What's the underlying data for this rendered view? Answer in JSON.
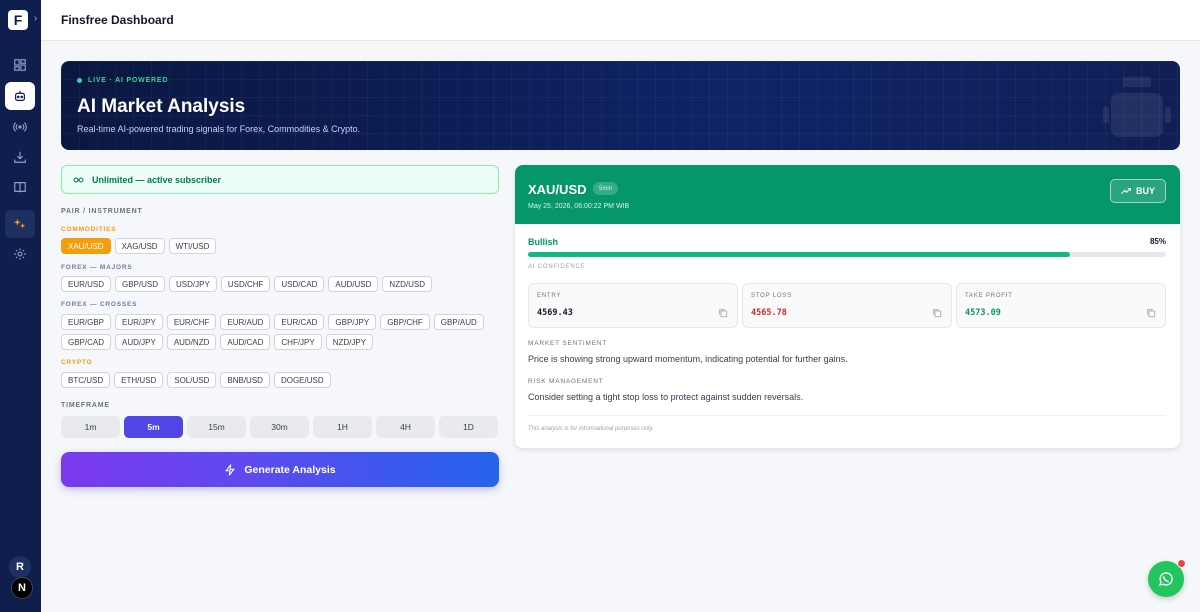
{
  "app": {
    "logo_letter": "F",
    "title": "Finsfree Dashboard"
  },
  "sidebar": {
    "items": [
      {
        "icon": "dashboard-icon"
      },
      {
        "icon": "robot-icon",
        "active": true
      },
      {
        "icon": "broadcast-icon"
      },
      {
        "icon": "download-icon"
      },
      {
        "icon": "book-icon"
      },
      {
        "icon": "sparkles-icon"
      },
      {
        "icon": "gear-icon"
      }
    ],
    "user_initial": "R",
    "user2_initial": "N"
  },
  "hero": {
    "badge": "LIVE · AI POWERED",
    "title": "AI Market Analysis",
    "subtitle": "Real-time AI-powered trading signals for Forex, Commodities & Crypto."
  },
  "subscription": {
    "text": "Unlimited — active subscriber"
  },
  "pairs": {
    "section_label": "PAIR / INSTRUMENT",
    "groups": [
      {
        "label": "COMMODITIES",
        "rows": [
          [
            "XAU/USD",
            "XAG/USD",
            "WTI/USD"
          ]
        ]
      },
      {
        "label": "FOREX — MAJORS",
        "rows": [
          [
            "EUR/USD",
            "GBP/USD",
            "USD/JPY",
            "USD/CHF",
            "USD/CAD",
            "AUD/USD",
            "NZD/USD"
          ]
        ]
      },
      {
        "label": "FOREX — CROSSES",
        "rows": [
          [
            "EUR/GBP",
            "EUR/JPY",
            "EUR/CHF",
            "EUR/AUD",
            "EUR/CAD",
            "GBP/JPY",
            "GBP/CHF",
            "GBP/AUD"
          ],
          [
            "GBP/CAD",
            "AUD/JPY",
            "AUD/NZD",
            "AUD/CAD",
            "CHF/JPY",
            "NZD/JPY"
          ]
        ]
      },
      {
        "label": "CRYPTO",
        "rows": [
          [
            "BTC/USD",
            "ETH/USD",
            "SOL/USD",
            "BNB/USD",
            "DOGE/USD"
          ]
        ]
      }
    ],
    "selected": "XAU/USD"
  },
  "timeframe": {
    "label": "TIMEFRAME",
    "options": [
      "1m",
      "5m",
      "15m",
      "30m",
      "1H",
      "4H",
      "1D"
    ],
    "selected": "5m"
  },
  "generate_button": "Generate Analysis",
  "result": {
    "pair": "XAU/USD",
    "timeframe_badge": "5min",
    "datetime": "May 25, 2026, 06:00:22 PM WIB",
    "signal": "BUY",
    "sentiment": "Bullish",
    "confidence_text": "85%",
    "confidence_value": 85,
    "confidence_label": "AI CONFIDENCE",
    "levels": [
      {
        "label": "ENTRY",
        "value": "4569.43",
        "kind": "entry"
      },
      {
        "label": "STOP LOSS",
        "value": "4565.78",
        "kind": "stop"
      },
      {
        "label": "TAKE PROFIT",
        "value": "4573.09",
        "kind": "tp"
      }
    ],
    "market_sentiment_label": "MARKET SENTIMENT",
    "market_sentiment_text": "Price is showing strong upward momentum, indicating potential for further gains.",
    "risk_label": "RISK MANAGEMENT",
    "risk_text": "Consider setting a tight stop loss to protect against sudden reversals.",
    "disclaimer": "This analysis is for informational purposes only."
  },
  "colors": {
    "brand": "#0f1f4d",
    "buy": "#059669",
    "stop": "#dc2626",
    "accent": "#4f46e5",
    "selected_pair": "#f59e0b"
  }
}
